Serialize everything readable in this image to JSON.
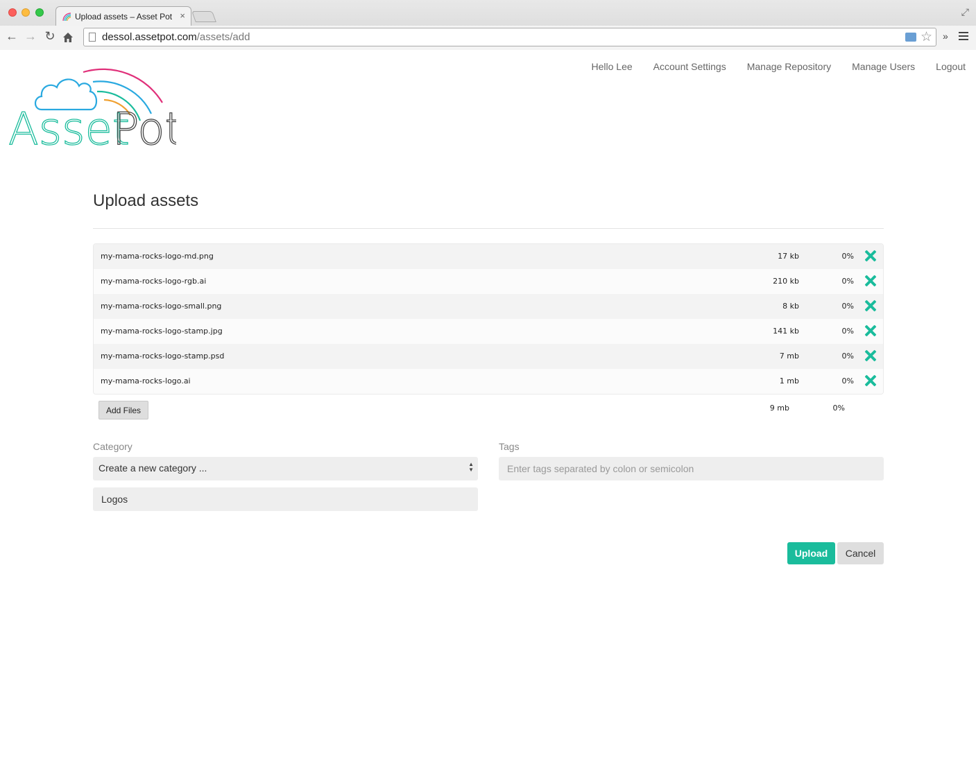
{
  "browser": {
    "tab_title": "Upload assets – Asset Pot",
    "tab_close": "×",
    "url_host": "dessol.assetpot.com",
    "url_path": "/assets/add"
  },
  "logo": {
    "text_left": "Asset",
    "text_right": "Pot"
  },
  "nav": {
    "greeting": "Hello Lee",
    "account_settings": "Account Settings",
    "manage_repository": "Manage Repository",
    "manage_users": "Manage Users",
    "logout": "Logout"
  },
  "page": {
    "title": "Upload assets"
  },
  "files": [
    {
      "name": "my-mama-rocks-logo-md.png",
      "size": "17 kb",
      "progress": "0%"
    },
    {
      "name": "my-mama-rocks-logo-rgb.ai",
      "size": "210 kb",
      "progress": "0%"
    },
    {
      "name": "my-mama-rocks-logo-small.png",
      "size": "8 kb",
      "progress": "0%"
    },
    {
      "name": "my-mama-rocks-logo-stamp.jpg",
      "size": "141 kb",
      "progress": "0%"
    },
    {
      "name": "my-mama-rocks-logo-stamp.psd",
      "size": "7 mb",
      "progress": "0%"
    },
    {
      "name": "my-mama-rocks-logo.ai",
      "size": "1 mb",
      "progress": "0%"
    }
  ],
  "totals": {
    "size": "9 mb",
    "progress": "0%"
  },
  "add_files_label": "Add Files",
  "form": {
    "category_label": "Category",
    "category_selected": "Create a new category ...",
    "new_category_value": "Logos",
    "tags_label": "Tags",
    "tags_placeholder": "Enter tags separated by colon or semicolon"
  },
  "buttons": {
    "upload": "Upload",
    "cancel": "Cancel"
  },
  "colors": {
    "accent": "#1abc9c",
    "logo_cloud": "#29a9e0",
    "logo_pink": "#e0307a",
    "logo_orange": "#f0a030",
    "logo_text": "#1abc9c"
  },
  "icons": {
    "back": "back-arrow-icon",
    "forward": "forward-arrow-icon",
    "reload": "reload-icon",
    "home": "home-icon",
    "star": "bookmark-star-icon",
    "remove": "remove-x-icon",
    "menu": "hamburger-menu-icon",
    "select_arrows": "select-arrows-icon"
  }
}
